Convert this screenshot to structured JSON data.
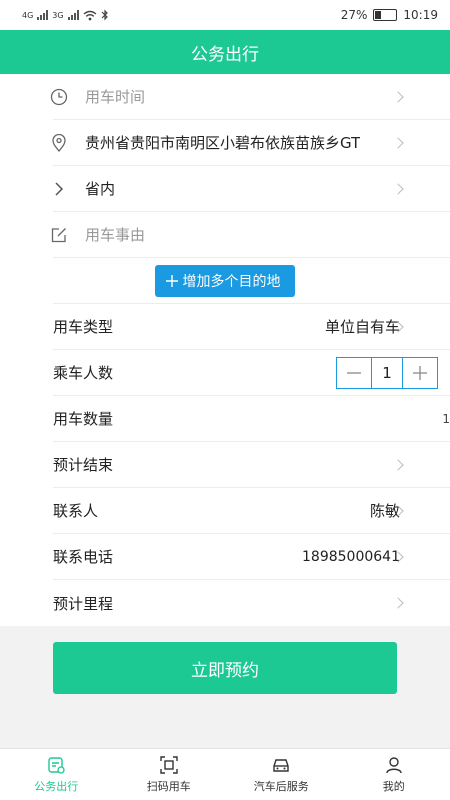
{
  "status": {
    "network_left": "4G",
    "network_right": "3G",
    "battery": "27%",
    "battery_level": 0.27,
    "time": "10:19"
  },
  "header": {
    "title": "公务出行"
  },
  "form": {
    "time_placeholder": "用车时间",
    "address": "贵州省贵阳市南明区小碧布依族苗族乡GT",
    "scope": "省内",
    "reason_placeholder": "用车事由",
    "add_destination": "增加多个目的地",
    "vehicle_type": {
      "label": "用车类型",
      "value": "单位自有车"
    },
    "passengers": {
      "label": "乘车人数",
      "value": "1"
    },
    "vehicle_count": {
      "label": "用车数量",
      "value": "1"
    },
    "estimated_end": {
      "label": "预计结束",
      "value": ""
    },
    "contact": {
      "label": "联系人",
      "value": "陈敏"
    },
    "phone": {
      "label": "联系电话",
      "value": "18985000641"
    },
    "mileage": {
      "label": "预计里程",
      "value": ""
    }
  },
  "submit": {
    "label": "立即预约"
  },
  "tabs": [
    {
      "label": "公务出行",
      "icon": "travel-icon",
      "active": true
    },
    {
      "label": "扫码用车",
      "icon": "scan-icon",
      "active": false
    },
    {
      "label": "汽车后服务",
      "icon": "car-icon",
      "active": false
    },
    {
      "label": "我的",
      "icon": "user-icon",
      "active": false
    }
  ],
  "colors": {
    "brand": "#1dc993",
    "accent": "#1a9ae0"
  }
}
